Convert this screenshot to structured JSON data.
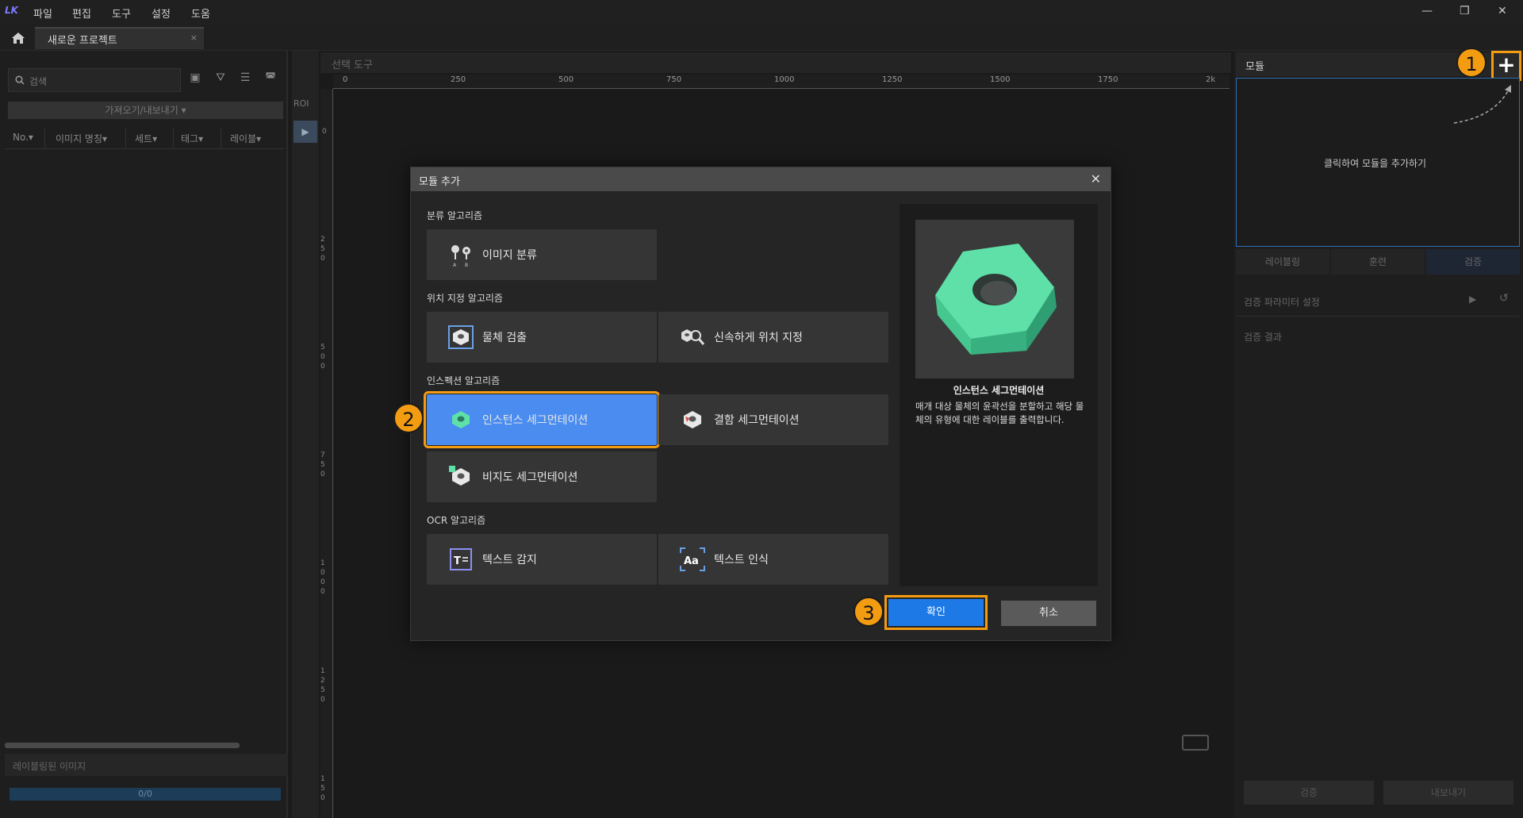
{
  "menu": [
    "파일",
    "편집",
    "도구",
    "설정",
    "도움"
  ],
  "app_logo": "LK",
  "project_tab": {
    "label": "새로운 프로젝트",
    "close": "×"
  },
  "left": {
    "search_placeholder": "검색",
    "import_export": "가져오기/내보내기 ▾",
    "columns": [
      "No.▾",
      "이미지 명칭▾",
      "세트▾",
      "태그▾",
      "레이블▾"
    ],
    "labeled_images": "레이블링된 이미지",
    "progress": "0/0"
  },
  "canvas": {
    "select_tool": "선택 도구",
    "roi": "ROI",
    "ruler_top": [
      "0",
      "250",
      "500",
      "750",
      "1000",
      "1250",
      "1500",
      "1750",
      "2k"
    ],
    "ruler_left": [
      [
        "0"
      ],
      [
        "2",
        "5",
        "0"
      ],
      [
        "5",
        "0",
        "0"
      ],
      [
        "7",
        "5",
        "0"
      ],
      [
        "1",
        "0",
        "0",
        "0"
      ],
      [
        "1",
        "2",
        "5",
        "0"
      ],
      [
        "1",
        "5",
        "0"
      ]
    ]
  },
  "right": {
    "module_title": "모듈",
    "add_button": "+",
    "module_hint": "클릭하여 모듈을 추가하기",
    "tabs": [
      "레이블링",
      "훈련",
      "검증"
    ],
    "verify_params": "검증 파라미터 설정",
    "verify_result": "검증 결과",
    "verify_button": "검증",
    "export_button": "내보내기"
  },
  "dialog": {
    "title": "모듈 추가",
    "close": "✕",
    "sections": {
      "classification": "분류 알고리즘",
      "location": "위치 지정 알고리즘",
      "inspection": "인스펙션 알고리즘",
      "ocr": "OCR 알고리즘"
    },
    "modules": {
      "image_classification": "이미지 분류",
      "object_detection": "물체 검출",
      "fast_positioning": "신속하게 위치 지정",
      "instance_segmentation": "인스턴스 세그먼테이션",
      "defect_segmentation": "결함 세그먼테이션",
      "unsupervised_segmentation": "비지도 세그먼테이션",
      "text_detection": "텍스트 감지",
      "text_recognition": "텍스트 인식"
    },
    "preview_title": "인스턴스 세그먼테이션",
    "preview_desc": "매개 대상 물체의 윤곽선을 분할하고 해당 물체의 유형에 대한 레이블를 출력합니다.",
    "ok": "확인",
    "cancel": "취소"
  },
  "callouts": [
    "1",
    "2",
    "3"
  ],
  "colors": {
    "accent": "#f39c12",
    "primary": "#1c79e6",
    "selected": "#4a8cf0",
    "nut": "#5ee0a8"
  }
}
